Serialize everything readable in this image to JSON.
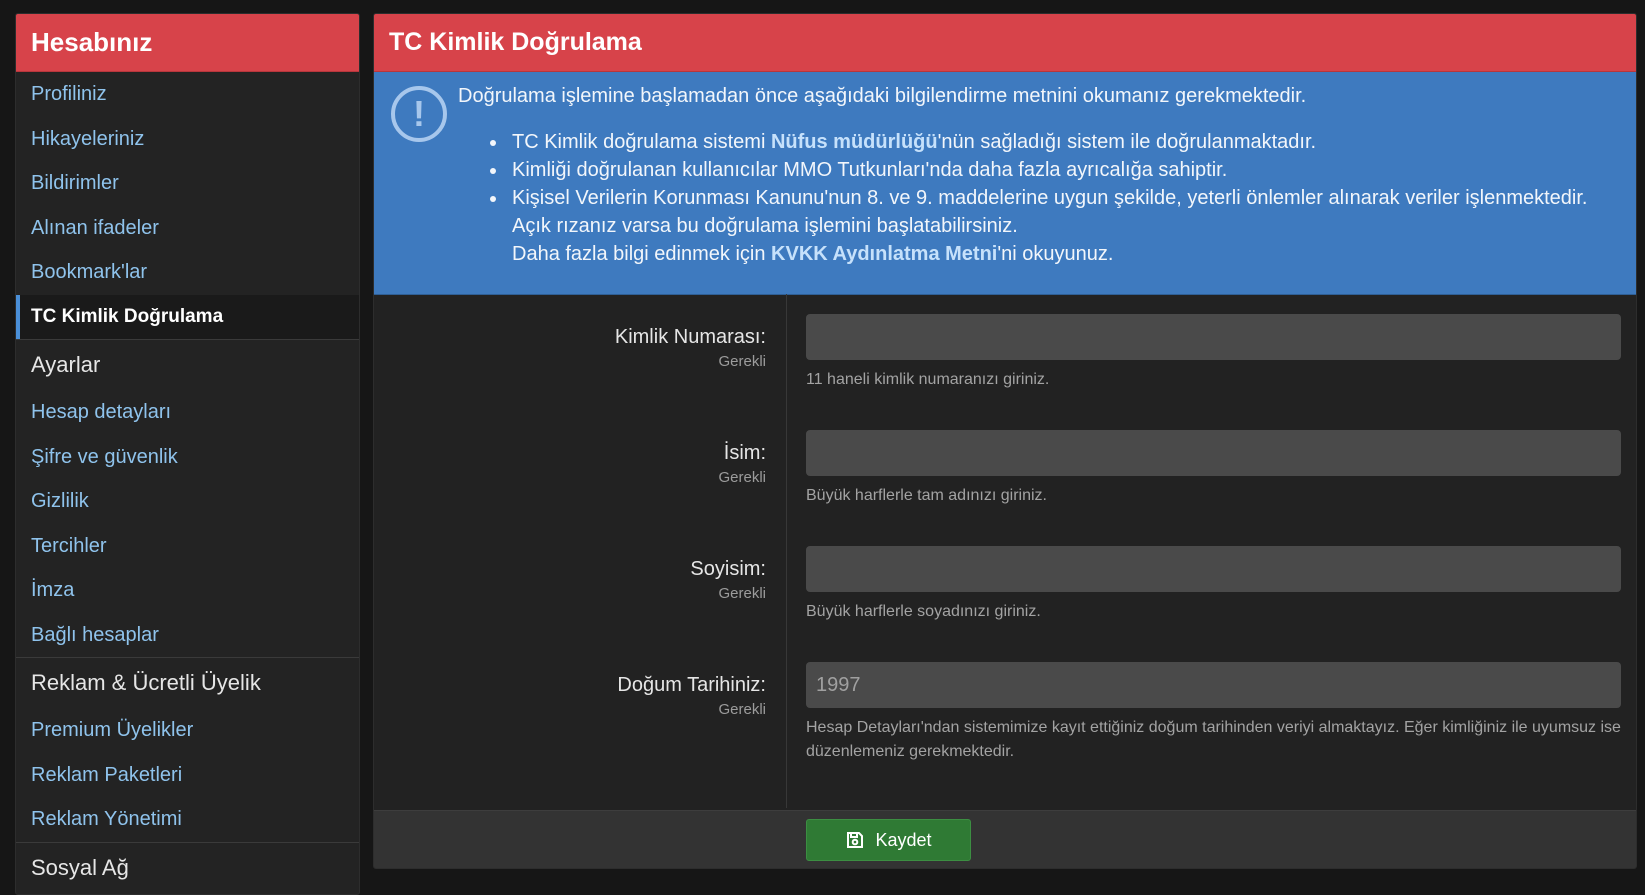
{
  "sidebar": {
    "title": "Hesabınız",
    "account_items": [
      {
        "label": "Profiliniz"
      },
      {
        "label": "Hikayeleriniz"
      },
      {
        "label": "Bildirimler"
      },
      {
        "label": "Alınan ifadeler"
      },
      {
        "label": "Bookmark'lar"
      },
      {
        "label": "TC Kimlik Doğrulama",
        "active": true
      }
    ],
    "settings_title": "Ayarlar",
    "settings_items": [
      {
        "label": "Hesap detayları"
      },
      {
        "label": "Şifre ve güvenlik"
      },
      {
        "label": "Gizlilik"
      },
      {
        "label": "Tercihler"
      },
      {
        "label": "İmza"
      },
      {
        "label": "Bağlı hesaplar"
      }
    ],
    "ads_title": "Reklam & Ücretli Üyelik",
    "ads_items": [
      {
        "label": "Premium Üyelikler"
      },
      {
        "label": "Reklam Paketleri"
      },
      {
        "label": "Reklam Yönetimi"
      }
    ],
    "social_title": "Sosyal Ağ"
  },
  "main": {
    "title": "TC Kimlik Doğrulama",
    "notice": {
      "icon": "exclamation-circle-icon",
      "lead": "Doğrulama işlemine başlamadan önce aşağıdaki bilgilendirme metnini okumanız gerekmektedir.",
      "b1_pre": "TC Kimlik doğrulama sistemi ",
      "b1_link": "Nüfus müdürlüğü",
      "b1_post": "'nün sağladığı sistem ile doğrulanmaktadır.",
      "b2": "Kimliği doğrulanan kullanıcılar MMO Tutkunları'nda daha fazla ayrıcalığa sahiptir.",
      "b3_line1": "Kişisel Verilerin Korunması Kanunu'nun 8. ve 9. maddelerine uygun şekilde, yeterli önlemler alınarak veriler işlenmektedir.",
      "b3_line2": "Açık rızanız varsa bu doğrulama işlemini başlatabilirsiniz.",
      "b3_line3_pre": "Daha fazla bilgi edinmek için ",
      "b3_line3_link": "KVKK Aydınlatma Metni",
      "b3_line3_post": "'ni okuyunuz."
    },
    "fields": {
      "tc": {
        "label": "Kimlik Numarası:",
        "required": "Gerekli",
        "value": "",
        "hint": "11 haneli kimlik numaranızı giriniz."
      },
      "name": {
        "label": "İsim:",
        "required": "Gerekli",
        "value": "",
        "hint": "Büyük harflerle tam adınızı giriniz."
      },
      "surname": {
        "label": "Soyisim:",
        "required": "Gerekli",
        "value": "",
        "hint": "Büyük harflerle soyadınızı giriniz."
      },
      "birth": {
        "label": "Doğum Tarihiniz:",
        "required": "Gerekli",
        "value": "1997",
        "hint": "Hesap Detayları'ndan sistemimize kayıt ettiğiniz doğum tarihinden veriyi almaktayız. Eğer kimliğiniz ile uyumsuz ise düzenlemeniz gerekmektedir."
      }
    },
    "save_label": "Kaydet",
    "save_icon": "save-icon"
  },
  "colors": {
    "header_red": "#d7434a",
    "notice_blue": "#3e7abf",
    "link_blue": "#8fc3ec",
    "save_green": "#2f7a34"
  }
}
